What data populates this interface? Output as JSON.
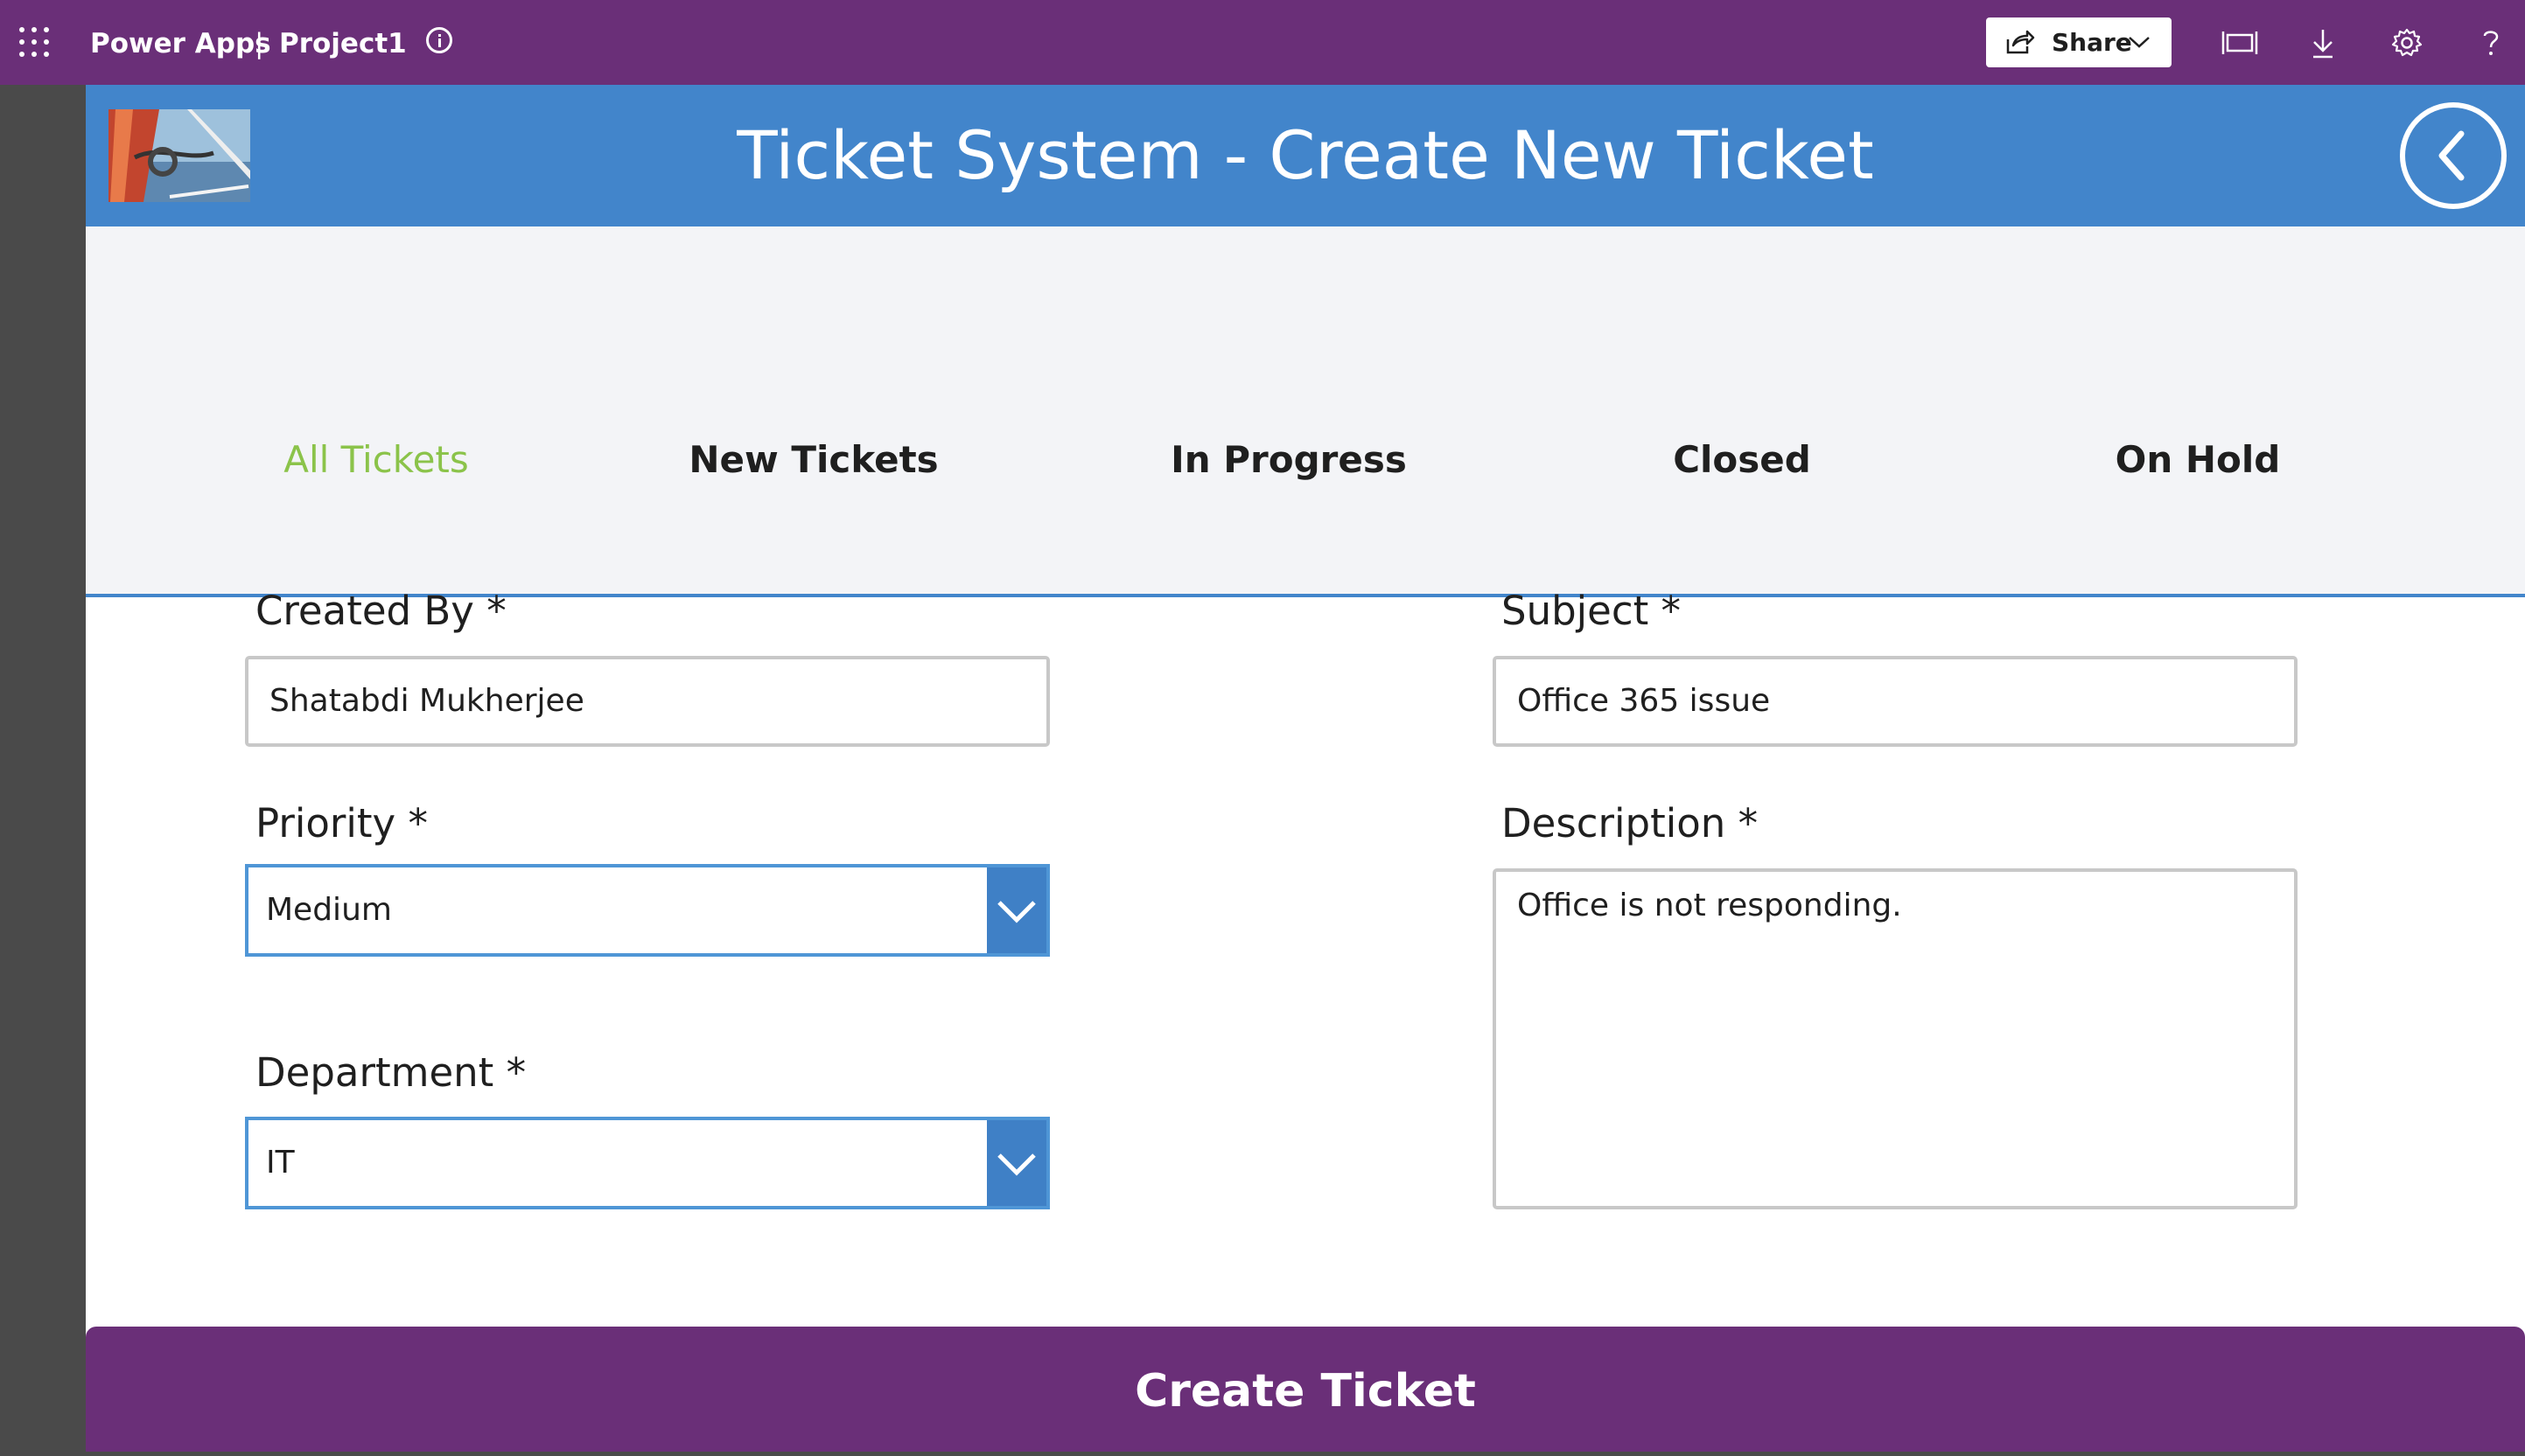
{
  "suite_bar": {
    "app_name": "Power Apps",
    "separator": "|",
    "project_name": "Project1",
    "share_label": "Share",
    "icons": [
      "waffle-icon",
      "info-icon",
      "share-icon",
      "chevron-down-icon",
      "fit-to-window-icon",
      "download-icon",
      "settings-icon",
      "help-icon"
    ],
    "background_color": "#6a2f78"
  },
  "header": {
    "title": "Ticket System - Create New Ticket",
    "background_color": "#4285cb",
    "logo": "sailboat-photo",
    "back_icon": "chevron-left-icon"
  },
  "nav": {
    "tabs": [
      {
        "label": "All Tickets",
        "active": true
      },
      {
        "label": "New Tickets",
        "active": false
      },
      {
        "label": "In Progress",
        "active": false
      },
      {
        "label": "Closed",
        "active": false
      },
      {
        "label": "On Hold",
        "active": false
      }
    ],
    "active_color": "#8bc34a"
  },
  "form": {
    "created_by": {
      "label": "Created By *",
      "value": "Shatabdi Mukherjee"
    },
    "priority": {
      "label": "Priority *",
      "value": "Medium"
    },
    "department": {
      "label": "Department *",
      "value": "IT"
    },
    "subject": {
      "label": "Subject *",
      "value": "Office 365 issue"
    },
    "description": {
      "label": "Description *",
      "value": "Office is not responding."
    }
  },
  "submit": {
    "label": "Create Ticket",
    "color": "#6a2f78"
  }
}
